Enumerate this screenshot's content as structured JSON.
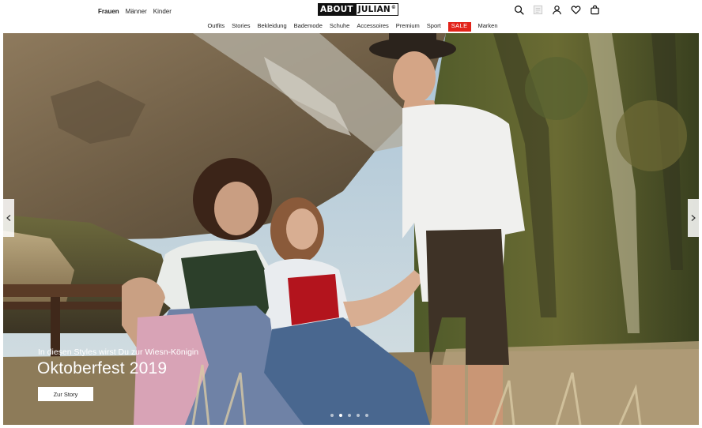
{
  "header": {
    "gender_tabs": [
      {
        "label": "Frauen",
        "active": true
      },
      {
        "label": "Männer",
        "active": false
      },
      {
        "label": "Kinder",
        "active": false
      }
    ],
    "logo": {
      "part1": "ABOUT",
      "part2": "JULIAN",
      "mark": "©"
    },
    "icons": [
      "search-icon",
      "profile-card-icon",
      "account-icon",
      "wishlist-heart-icon",
      "shopping-bag-icon"
    ]
  },
  "nav": {
    "items": [
      "Outfits",
      "Stories",
      "Bekleidung",
      "Bademode",
      "Schuhe",
      "Accessoires",
      "Premium",
      "Sport",
      "SALE",
      "Marken"
    ],
    "sale_color": "#e2231a"
  },
  "hero": {
    "subtitle": "In diesen Styles wirst Du zur Wiesn-Königin",
    "title": "Oktoberfest 2019",
    "cta": "Zur Story",
    "slides_total": 5,
    "active_slide": 2,
    "arrows": [
      "chevron-left-icon",
      "chevron-right-icon"
    ]
  }
}
